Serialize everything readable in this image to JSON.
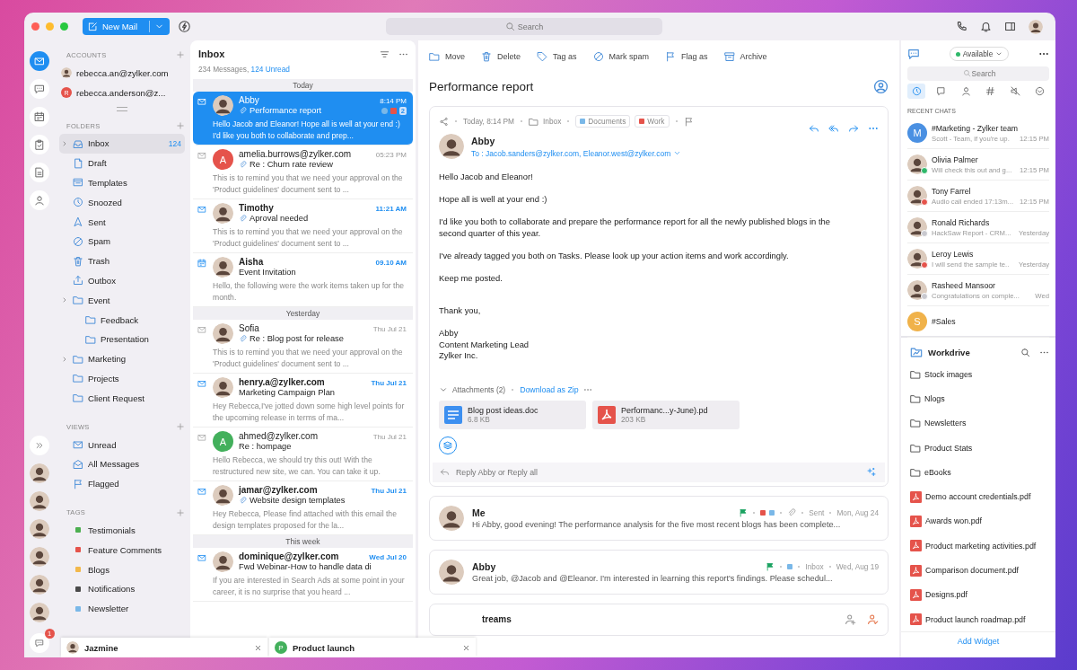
{
  "top_bar": {
    "new_mail": "New Mail",
    "search": {
      "placeholder": "Search"
    }
  },
  "rail": {
    "apps": [
      {
        "kind": "mail",
        "selected": true
      },
      {
        "kind": "chat",
        "selected": false
      },
      {
        "kind": "calendar",
        "selected": false
      },
      {
        "kind": "tasks",
        "selected": false
      },
      {
        "kind": "notes",
        "selected": false
      },
      {
        "kind": "contacts",
        "selected": false
      }
    ],
    "chat_badge": "1"
  },
  "sidebar": {
    "accounts": {
      "title": "ACCOUNTS",
      "items": [
        {
          "email": "rebecca.an@zylker.com",
          "kind": "photo"
        },
        {
          "email": "rebecca.anderson@z...",
          "kind": "initial",
          "initial": "R",
          "color": "#e5534b"
        }
      ]
    },
    "folders": {
      "title": "FOLDERS",
      "items": [
        {
          "label": "Inbox",
          "kind": "inbox",
          "count": "124",
          "collapsible": true,
          "selected": true
        },
        {
          "label": "Draft",
          "kind": "draft",
          "collapsible": false,
          "selected": false
        },
        {
          "label": "Templates",
          "kind": "templates",
          "collapsible": false,
          "selected": false
        },
        {
          "label": "Snoozed",
          "kind": "snoozed",
          "collapsible": false,
          "selected": false
        },
        {
          "label": "Sent",
          "kind": "sent",
          "collapsible": false,
          "selected": false
        },
        {
          "label": "Spam",
          "kind": "spam",
          "collapsible": false,
          "selected": false
        },
        {
          "label": "Trash",
          "kind": "trash",
          "collapsible": false,
          "selected": false
        },
        {
          "label": "Outbox",
          "kind": "outbox",
          "collapsible": false,
          "selected": false
        },
        {
          "label": "Event",
          "kind": "folder",
          "collapsible": true,
          "selected": false,
          "children": [
            {
              "label": "Feedback",
              "kind": "folder",
              "selected": false
            },
            {
              "label": "Presentation",
              "kind": "folder",
              "selected": false
            }
          ]
        },
        {
          "label": "Marketing",
          "kind": "folder",
          "collapsible": true,
          "selected": false
        },
        {
          "label": "Projects",
          "kind": "folder",
          "collapsible": false,
          "selected": false
        },
        {
          "label": "Client Request",
          "kind": "folder",
          "collapsible": false,
          "selected": false
        }
      ]
    },
    "views": {
      "title": "VIEWS",
      "items": [
        {
          "label": "Unread",
          "kind": "unread",
          "selected": false
        },
        {
          "label": "All Messages",
          "kind": "all",
          "selected": false
        },
        {
          "label": "Flagged",
          "kind": "flag",
          "selected": false
        }
      ]
    },
    "tags": {
      "title": "TAGS",
      "items": [
        {
          "label": "Testimonials",
          "color": "#4caf50"
        },
        {
          "label": "Feature Comments",
          "color": "#e5534b"
        },
        {
          "label": "Blogs",
          "color": "#f2b84b"
        },
        {
          "label": "Notifications",
          "color": "#4a4a4a"
        },
        {
          "label": "Newsletter",
          "color": "#7ab8e8"
        }
      ]
    }
  },
  "mail_list": {
    "title": "Inbox",
    "count": "234 Messages,",
    "unread": "124 Unread",
    "groups": [
      {
        "label": "Today",
        "mails": [
          {
            "sender": "Abby",
            "subject": "Performance report",
            "preview": "Hello Jacob and Eleanor! Hope all is well at your end :) I'd like you both to collaborate and prep...",
            "time": "8:14 PM",
            "kind": "mail",
            "unread": false,
            "attachment": true,
            "selected": true,
            "avatar": {
              "kind": "photo"
            },
            "tags": [
              {
                "color": "#7ab8e8"
              },
              {
                "color": "#e5534b"
              }
            ],
            "thread_count": "2"
          },
          {
            "sender": "amelia.burrows@zylker.com",
            "subject": "Re :  Churn rate review",
            "preview": "This is to remind you that we need your approval on the 'Product guidelines' document sent to ...",
            "time": "05:23 PM",
            "kind": "mail",
            "unread": false,
            "attachment": true,
            "selected": false,
            "avatar": {
              "kind": "initial",
              "initial": "A",
              "color": "#e5534b"
            }
          },
          {
            "sender": "Timothy",
            "subject": "Aproval needed",
            "preview": "This is to remind you that we need your approval on the 'Product guidelines' document sent to ...",
            "time": "11:21 AM",
            "kind": "mail",
            "unread": true,
            "attachment": true,
            "selected": false,
            "avatar": {
              "kind": "photo"
            }
          },
          {
            "sender": "Aisha",
            "subject": "Event Invitation",
            "preview": "Hello, the following were the work items taken up for the month.",
            "time": "09.10 AM",
            "kind": "invite",
            "unread": true,
            "attachment": false,
            "selected": false,
            "avatar": {
              "kind": "photo"
            }
          }
        ]
      },
      {
        "label": "Yesterday",
        "mails": [
          {
            "sender": "Sofia",
            "subject": "Re :  Blog post for release",
            "preview": "This is to remind you that we need your approval on the 'Product guidelines' document sent to ...",
            "time": "Thu Jul 21",
            "kind": "mail",
            "unread": false,
            "attachment": true,
            "selected": false,
            "avatar": {
              "kind": "photo"
            }
          },
          {
            "sender": "henry.a@zylker.com",
            "subject": "Marketing Campaign Plan",
            "preview": "Hey Rebecca,I've jotted down some high level points for the upcoming release  in terms of ma...",
            "time": "Thu Jul 21",
            "kind": "mail",
            "unread": true,
            "attachment": false,
            "selected": false,
            "avatar": {
              "kind": "photo"
            }
          },
          {
            "sender": "ahmed@zylker.com",
            "subject": "Re :  hompage",
            "preview": "Hello Rebecca, we should try this out! With the restructured new site, we can. You can take it up.",
            "time": "Thu Jul 21",
            "kind": "mail",
            "unread": false,
            "attachment": false,
            "selected": false,
            "avatar": {
              "kind": "initial",
              "initial": "A",
              "color": "#43b05c"
            }
          },
          {
            "sender": "jamar@zylker.com",
            "subject": "Website design templates",
            "preview": "Hey Rebecca, Please find attached with this email the design templates proposed for the la...",
            "time": "Thu Jul 21",
            "kind": "mail",
            "unread": true,
            "attachment": true,
            "selected": false,
            "avatar": {
              "kind": "photo"
            }
          }
        ]
      },
      {
        "label": "This week",
        "mails": [
          {
            "sender": "dominique@zylker.com",
            "subject": "Fwd  Webinar-How to handle data di",
            "preview": "If you are interested in Search Ads at some point in your career, it is no surprise that you heard ...",
            "time": "Wed Jul 20",
            "kind": "mail",
            "unread": true,
            "attachment": false,
            "selected": false,
            "avatar": {
              "kind": "photo"
            }
          }
        ]
      }
    ]
  },
  "reading": {
    "toolbar": [
      {
        "label": "Move",
        "kind": "folder"
      },
      {
        "label": "Delete",
        "kind": "trash"
      },
      {
        "label": "Tag as",
        "kind": "tag"
      },
      {
        "label": "Mark spam",
        "kind": "spam"
      },
      {
        "label": "Flag as",
        "kind": "flag"
      },
      {
        "label": "Archive",
        "kind": "archive"
      }
    ],
    "subject": "Performance report",
    "message": {
      "time": "Today, 8:14 PM",
      "folder": "Inbox",
      "tags": [
        {
          "label": "Documents",
          "color": "#7ab8e8"
        },
        {
          "label": "Work",
          "color": "#e5534b"
        }
      ],
      "sender": "Abby",
      "to": "To : Jacob.sanders@zylker.com, Eleanor.west@zylker.com",
      "body": [
        "Hello Jacob and Eleanor!",
        "Hope all is well at your end :)",
        "I'd like you both to collaborate and prepare the performance report for all the newly published blogs in the second quarter of this year.",
        "I've already tagged you both on Tasks. Please look up your action items and work accordingly.",
        "Keep me posted."
      ],
      "closing": "Thank you,",
      "signature": [
        "Abby",
        "Content Marketing Lead",
        "Zylker Inc."
      ],
      "attachments_label": "Attachments (2)",
      "download": "Download as Zip",
      "attachments": [
        {
          "name": "Blog post ideas.doc",
          "size": "6.8 KB",
          "kind": "doc"
        },
        {
          "name": "Performanc...y-June).pd",
          "size": "203 KB",
          "kind": "pdf"
        }
      ],
      "reply_placeholder": "Reply Abby or Reply all"
    },
    "thread": [
      {
        "sender": "Me",
        "preview": "Hi Abby, good evening! The performance analysis for the five most recent blogs has been complete...",
        "folder": "Sent",
        "date": "Mon, Aug 24",
        "flagged": true,
        "attachment": true,
        "tags": [
          {
            "color": "#e5534b"
          },
          {
            "color": "#7ab8e8"
          }
        ]
      },
      {
        "sender": "Abby",
        "preview": "Great job, @Jacob and @Eleanor. I'm interested in learning this report's findings. Please schedul...",
        "folder": "Inbox",
        "date": "Wed, Aug 19",
        "flagged": true,
        "attachment": false,
        "tags": [
          {
            "color": "#7ab8e8"
          }
        ]
      }
    ],
    "stream": {
      "label": "treams"
    }
  },
  "chat": {
    "status": "Available",
    "search": {
      "placeholder": "Search"
    },
    "tabs": [
      {
        "kind": "clock",
        "selected": true
      },
      {
        "kind": "chatsq",
        "selected": false
      },
      {
        "kind": "user",
        "selected": false
      },
      {
        "kind": "hash",
        "selected": false
      },
      {
        "kind": "mute",
        "selected": false
      },
      {
        "kind": "expand",
        "selected": false
      }
    ],
    "heading": "RECENT CHATS",
    "items": [
      {
        "name": "#Marketing - Zylker team",
        "preview": "Scott - Team, if you're up.",
        "time": "12:15 PM",
        "avatar": {
          "kind": "initial",
          "initial": "M",
          "color": "#4a90e2"
        }
      },
      {
        "name": "Olivia Palmer",
        "preview": "Will check this out and g...",
        "time": "12:15 PM",
        "avatar": {
          "kind": "photo"
        },
        "color": "#2fb86a"
      },
      {
        "name": "Tony Farrel",
        "preview": "Audio call ended 17:13m...",
        "time": "12:15 PM",
        "avatar": {
          "kind": "photo"
        },
        "color": "#e5534b"
      },
      {
        "name": "Ronald Richards",
        "preview": "HackSaw Report - CRM...",
        "time": "Yesterday",
        "avatar": {
          "kind": "photo"
        },
        "color": "#c9c9cf"
      },
      {
        "name": "Leroy Lewis",
        "preview": "I will send the sample te..",
        "time": "Yesterday",
        "avatar": {
          "kind": "photo"
        },
        "color": "#e5534b"
      },
      {
        "name": "Rasheed Mansoor",
        "preview": "Congratulations on comple...",
        "time": "Wed",
        "avatar": {
          "kind": "photo"
        },
        "color": "#c9c9cf"
      },
      {
        "name": "#Sales",
        "avatar": {
          "kind": "initial",
          "initial": "S",
          "color": "#f0b24a"
        }
      }
    ]
  },
  "workdrive": {
    "title": "Workdrive",
    "items": [
      {
        "name": "Stock images",
        "kind": "folder"
      },
      {
        "name": "Nlogs",
        "kind": "folder"
      },
      {
        "name": "Newsletters",
        "kind": "folder"
      },
      {
        "name": "Product Stats",
        "kind": "folder"
      },
      {
        "name": "eBooks",
        "kind": "folder"
      },
      {
        "name": "Demo account credentials.pdf",
        "kind": "pdf"
      },
      {
        "name": "Awards won.pdf",
        "kind": "pdf"
      },
      {
        "name": "Product marketing activities.pdf",
        "kind": "pdf"
      },
      {
        "name": "Comparison document.pdf",
        "kind": "pdf"
      },
      {
        "name": "Designs.pdf",
        "kind": "pdf"
      },
      {
        "name": "Product launch roadmap.pdf",
        "kind": "pdf"
      }
    ],
    "add_widget": "Add Widget"
  },
  "chat_tabs": [
    {
      "label": "Jazmine",
      "avatar": {
        "kind": "photo"
      }
    },
    {
      "label": "Product launch",
      "avatar": {
        "kind": "initial",
        "initial": "P",
        "color": "#43b05c"
      }
    }
  ]
}
